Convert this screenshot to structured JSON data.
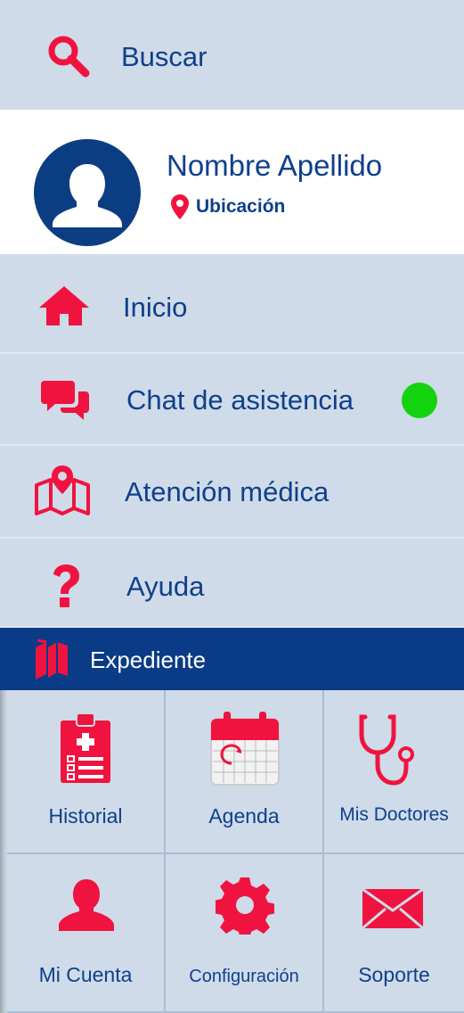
{
  "search": {
    "label": "Buscar",
    "icon": "search-icon"
  },
  "profile": {
    "name": "Nombre Apellido",
    "location": "Ubicación"
  },
  "menu": {
    "items": [
      {
        "label": "Inicio",
        "icon": "home-icon"
      },
      {
        "label": "Chat de asistencia",
        "icon": "chat-icon",
        "status": "online"
      },
      {
        "label": "Atención médica",
        "icon": "map-pin-icon"
      },
      {
        "label": "Ayuda",
        "icon": "question-icon"
      }
    ]
  },
  "section": {
    "label": "Expediente",
    "icon": "books-icon"
  },
  "grid": {
    "items": [
      {
        "label": "Historial",
        "icon": "clipboard-icon"
      },
      {
        "label": "Agenda",
        "icon": "calendar-icon"
      },
      {
        "label": "Mis Doctores",
        "icon": "stethoscope-icon"
      },
      {
        "label": "Mi Cuenta",
        "icon": "user-icon"
      },
      {
        "label": "Configuración",
        "icon": "gear-icon"
      },
      {
        "label": "Soporte",
        "icon": "envelope-icon"
      }
    ]
  },
  "colors": {
    "accent": "#f0133f",
    "primary": "#0f3f8c",
    "header": "#0a3b86",
    "background": "#cfdbe8",
    "online": "#13d30f"
  }
}
